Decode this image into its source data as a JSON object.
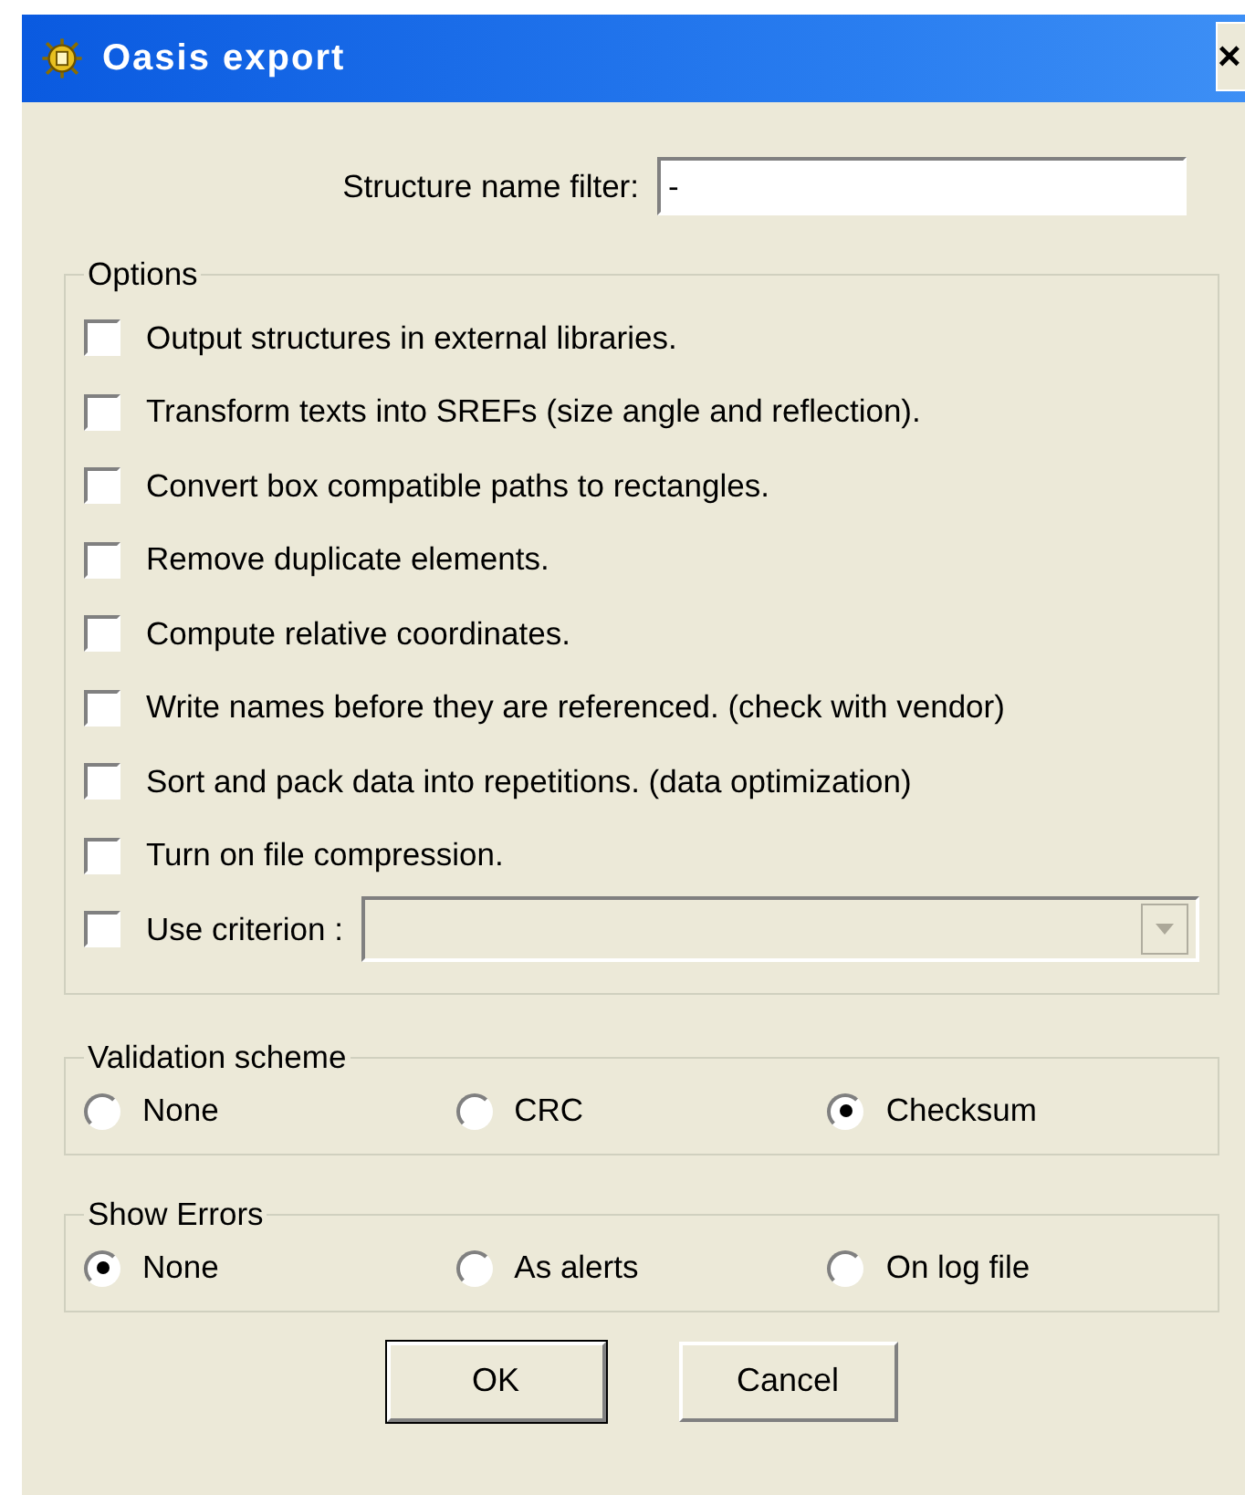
{
  "window": {
    "title": "Oasis export",
    "close": "×"
  },
  "filter": {
    "label": "Structure name filter:",
    "value": "-"
  },
  "options": {
    "title": "Options",
    "items": [
      {
        "kind": "checkbox",
        "label": "Output structures in external libraries.",
        "checked": false
      },
      {
        "kind": "checkbox",
        "label": "Transform texts into SREFs (size angle and reflection).",
        "checked": false
      },
      {
        "kind": "checkbox",
        "label": "Convert box compatible paths to rectangles.",
        "checked": false
      },
      {
        "kind": "checkbox",
        "label": "Remove duplicate elements.",
        "checked": false
      },
      {
        "kind": "checkbox",
        "label": "Compute relative coordinates.",
        "checked": false
      },
      {
        "kind": "checkbox",
        "label": "Write names before they are referenced. (check with vendor)",
        "checked": false
      },
      {
        "kind": "checkbox",
        "label": "Sort and pack data into repetitions. (data optimization)",
        "checked": false
      },
      {
        "kind": "checkbox",
        "label": "Turn on file compression.",
        "checked": false
      },
      {
        "kind": "combo",
        "label": "Use criterion :",
        "checked": false,
        "disabled": true
      }
    ]
  },
  "groups": [
    {
      "title": "Validation scheme",
      "items": [
        {
          "label": "None",
          "selected": false
        },
        {
          "label": "CRC",
          "selected": false
        },
        {
          "label": "Checksum",
          "selected": true
        }
      ]
    },
    {
      "title": "Show Errors",
      "items": [
        {
          "label": "None",
          "selected": true
        },
        {
          "label": "As alerts",
          "selected": false
        },
        {
          "label": "On log file",
          "selected": false
        }
      ]
    }
  ],
  "buttons": [
    {
      "label": "OK",
      "default": true
    },
    {
      "label": "Cancel",
      "default": false
    }
  ]
}
